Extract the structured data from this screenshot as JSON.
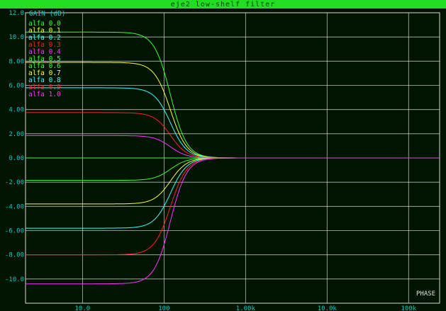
{
  "window": {
    "title": "eje2 low-shelf filter"
  },
  "colors": {
    "background": "#001400",
    "grid": "#d8d8d8",
    "axis_text": "#00c8c8",
    "titlebar": "#22dd22"
  },
  "chart_data": {
    "type": "line",
    "title": "eje2 low-shelf filter",
    "ylabel": "GAIN (dB)",
    "xlabel": "",
    "corner_label": "PHASE",
    "xscale": "log",
    "xlim": [
      2,
      240
    ],
    "ylim": [
      -12,
      12
    ],
    "grid": true,
    "legend_position": "top-left",
    "x_ticks": [
      {
        "value": 10,
        "label": "10.0"
      },
      {
        "value": 100,
        "label": "100"
      },
      {
        "value": 1000,
        "label": "1.00k"
      },
      {
        "value": 10000,
        "label": "10.0k"
      },
      {
        "value": 100000,
        "label": "100k"
      }
    ],
    "y_ticks": [
      {
        "value": 12,
        "label": "12.0"
      },
      {
        "value": 10,
        "label": "10.0"
      },
      {
        "value": 8,
        "label": "8.00"
      },
      {
        "value": 6,
        "label": "6.00"
      },
      {
        "value": 4,
        "label": "4.00"
      },
      {
        "value": 2,
        "label": "2.00"
      },
      {
        "value": 0,
        "label": "0.00"
      },
      {
        "value": -2,
        "label": "-2.00"
      },
      {
        "value": -4,
        "label": "-4.00"
      },
      {
        "value": -6,
        "label": "-6.00"
      },
      {
        "value": -8,
        "label": "-8.00"
      },
      {
        "value": -10,
        "label": "-10.0"
      }
    ],
    "x_min": 2,
    "x_max": 240000,
    "transition": {
      "center_hz": 120,
      "width_decades": 0.22,
      "merge_hz": 1600
    },
    "series": [
      {
        "name": "alfa 0.0",
        "color": "#33ff33",
        "upper_db": 10.4,
        "lower_db": -10.4
      },
      {
        "name": "alfa 0.1",
        "color": "#ffff33",
        "upper_db": 7.9,
        "lower_db": -8.0
      },
      {
        "name": "alfa 0.2",
        "color": "#33ffff",
        "upper_db": 5.8,
        "lower_db": -5.8
      },
      {
        "name": "alfa 0.3",
        "color": "#ff2222",
        "upper_db": 3.75,
        "lower_db": -3.8
      },
      {
        "name": "alfa 0.4",
        "color": "#ff33ff",
        "upper_db": 1.85,
        "lower_db": -1.85
      },
      {
        "name": "alfa 0.5",
        "color": "#33ff33",
        "upper_db": 0.0,
        "lower_db": 0.0
      },
      {
        "name": "alfa 0.6",
        "color": "#33ff33",
        "upper_db": -1.85,
        "lower_db": -1.85
      },
      {
        "name": "alfa 0.7",
        "color": "#ffff33",
        "upper_db": -3.8,
        "lower_db": -3.8
      },
      {
        "name": "alfa 0.8",
        "color": "#33ffff",
        "upper_db": -5.8,
        "lower_db": -5.8
      },
      {
        "name": "alfa 0.9",
        "color": "#ff2222",
        "upper_db": -8.0,
        "lower_db": -8.0
      },
      {
        "name": "alfa 1.0",
        "color": "#ff33ff",
        "upper_db": -10.4,
        "lower_db": -10.4
      }
    ]
  }
}
